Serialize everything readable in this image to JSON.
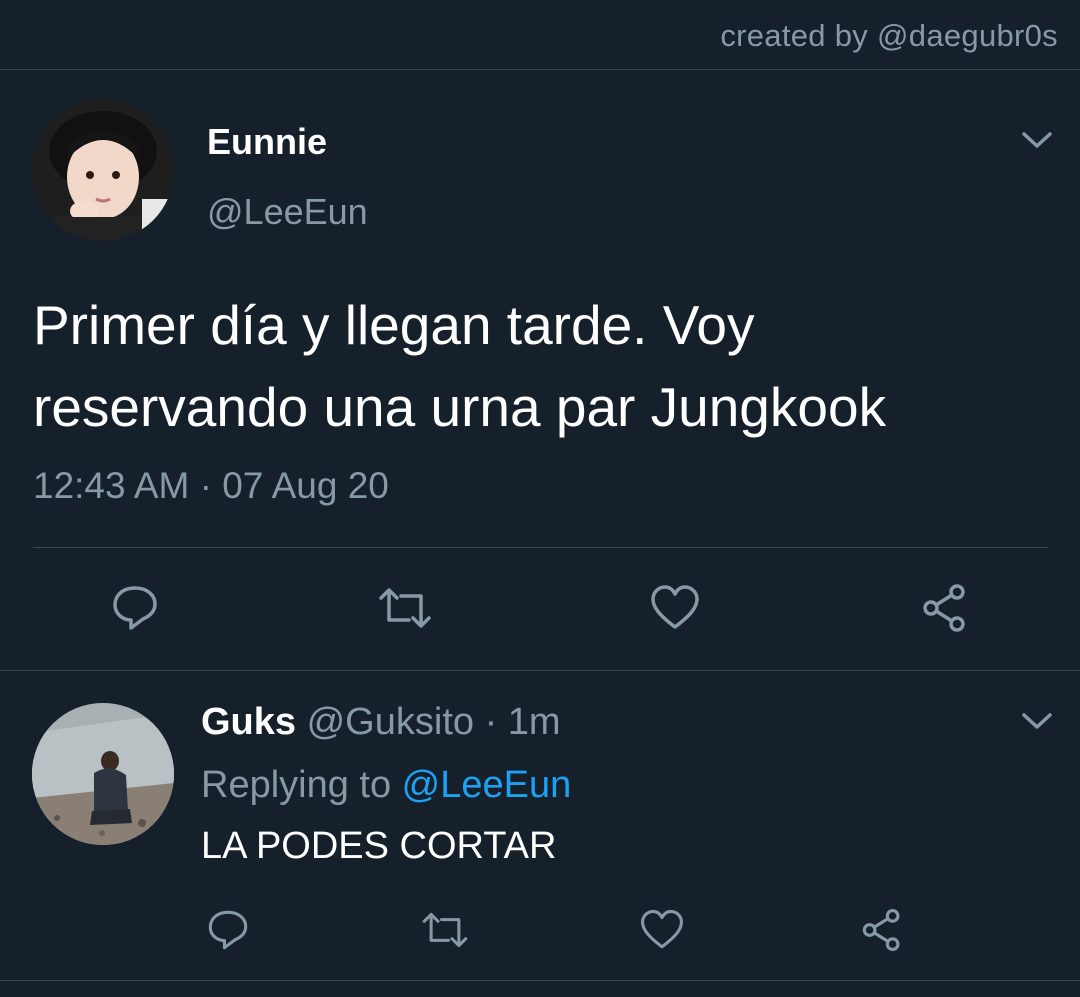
{
  "credit": "created by @daegubr0s",
  "tweet": {
    "author_name": "Eunnie",
    "author_handle": "@LeeEun",
    "text_line1": "Primer día y llegan tarde. Voy",
    "text_line2": "reservando una urna par Jungkook",
    "timestamp": "12:43 AM · 07 Aug 20",
    "actions": [
      "reply-icon",
      "retweet-icon",
      "like-icon",
      "share-icon"
    ]
  },
  "reply": {
    "author_name": "Guks",
    "author_handle": "@Guksito",
    "separator": " · ",
    "time": "1m",
    "replying_prefix": "Replying to ",
    "replying_mention": "@LeeEun",
    "text": "LA PODES CORTAR",
    "actions": [
      "reply-icon",
      "retweet-icon",
      "like-icon",
      "share-icon"
    ]
  },
  "colors": {
    "background": "#15202b",
    "secondary_text": "#8899a6",
    "link": "#1da1f2",
    "divider": "#38444d"
  }
}
